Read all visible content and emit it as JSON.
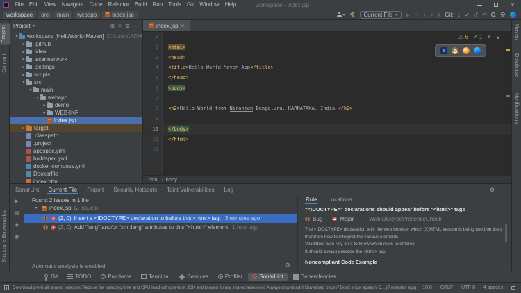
{
  "titlebar": {
    "menus": [
      "File",
      "Edit",
      "View",
      "Navigate",
      "Code",
      "Refactor",
      "Build",
      "Run",
      "Tools",
      "Git",
      "Window",
      "Help"
    ],
    "title": "workspace - index.jsp"
  },
  "toolbar": {
    "breadcrumbs": [
      "workspace",
      "src",
      "main",
      "webapp",
      "index.jsp"
    ],
    "run_config": "Current File",
    "git_label": "Git:"
  },
  "left_stripe": {
    "top": [
      "Project",
      "Commit"
    ],
    "bottom": [
      "Bookmarks",
      "Structure"
    ]
  },
  "right_stripe": [
    "Maven",
    "Database",
    "Notifications"
  ],
  "project": {
    "header": "Project",
    "tree": [
      {
        "label": "workspace [HelloWorld-Maven]",
        "suffix": "C:\\Users\\ADMIN\\jenkins",
        "indent": 0,
        "arrow": "down",
        "icon": "project"
      },
      {
        "label": ".github",
        "indent": 1,
        "arrow": "right",
        "icon": "folder"
      },
      {
        "label": ".idea",
        "indent": 1,
        "arrow": "right",
        "icon": "folder"
      },
      {
        "label": ".scannerwork",
        "indent": 1,
        "arrow": "right",
        "icon": "folder"
      },
      {
        "label": ".settings",
        "indent": 1,
        "arrow": "right",
        "icon": "folder"
      },
      {
        "label": "scripts",
        "indent": 1,
        "arrow": "right",
        "icon": "folder"
      },
      {
        "label": "src",
        "indent": 1,
        "arrow": "down",
        "icon": "folder"
      },
      {
        "label": "main",
        "indent": 2,
        "arrow": "down",
        "icon": "folder"
      },
      {
        "label": "webapp",
        "indent": 3,
        "arrow": "down",
        "icon": "folder"
      },
      {
        "label": "demo",
        "indent": 4,
        "arrow": "right",
        "icon": "folder"
      },
      {
        "label": "WEB-INF",
        "indent": 4,
        "arrow": "right",
        "icon": "folder"
      },
      {
        "label": "index.jsp",
        "indent": 4,
        "arrow": "none",
        "icon": "jsp",
        "selected": true
      },
      {
        "label": "target",
        "indent": 1,
        "arrow": "right",
        "icon": "folder-excluded",
        "excluded": true
      },
      {
        "label": ".classpath",
        "indent": 1,
        "arrow": "none",
        "icon": "config"
      },
      {
        "label": ".project",
        "indent": 1,
        "arrow": "none",
        "icon": "config"
      },
      {
        "label": "appspec.yml",
        "indent": 1,
        "arrow": "none",
        "icon": "yml"
      },
      {
        "label": "buildspec.yml",
        "indent": 1,
        "arrow": "none",
        "icon": "yml"
      },
      {
        "label": "docker-compose.yml",
        "indent": 1,
        "arrow": "none",
        "icon": "docker"
      },
      {
        "label": "Dockerfile",
        "indent": 1,
        "arrow": "none",
        "icon": "docker"
      },
      {
        "label": "index.html",
        "indent": 1,
        "arrow": "none",
        "icon": "html"
      }
    ]
  },
  "editor": {
    "tab": "index.jsp",
    "inspections": {
      "warnings": "6",
      "passed": "1"
    },
    "breadcrumb": [
      "html",
      "body"
    ],
    "browsers": [
      "ie",
      "chrome",
      "firefox",
      "edge"
    ],
    "lines": [
      {
        "n": "1",
        "segs": []
      },
      {
        "n": "2",
        "segs": [
          {
            "t": "<html>",
            "c": "tag hl-html"
          }
        ]
      },
      {
        "n": "3",
        "segs": [
          {
            "t": "<head>",
            "c": "tag"
          }
        ]
      },
      {
        "n": "4",
        "segs": [
          {
            "t": "<title>",
            "c": "tag"
          },
          {
            "t": "Hello World Maven App",
            "c": "txt"
          },
          {
            "t": "</title>",
            "c": "tag"
          }
        ]
      },
      {
        "n": "5",
        "segs": [
          {
            "t": "</head>",
            "c": "tag"
          }
        ]
      },
      {
        "n": "6",
        "segs": [
          {
            "t": "<body>",
            "c": "tag hl-body"
          }
        ]
      },
      {
        "n": "7",
        "segs": []
      },
      {
        "n": "8",
        "segs": [
          {
            "t": "<h2>",
            "c": "tag"
          },
          {
            "t": "Hello World from ",
            "c": "txt"
          },
          {
            "t": "Niranjan",
            "c": "txt typo"
          },
          {
            "t": " Bengaluru, KARNATAKA, India ",
            "c": "txt"
          },
          {
            "t": "</h2>",
            "c": "tag"
          }
        ]
      },
      {
        "n": "9",
        "segs": []
      },
      {
        "n": "10",
        "segs": [
          {
            "t": "</body>",
            "c": "tag hl-body"
          }
        ],
        "current": true
      },
      {
        "n": "11",
        "segs": [
          {
            "t": "</html>",
            "c": "tag"
          }
        ]
      },
      {
        "n": "12",
        "segs": []
      }
    ]
  },
  "sonarlint": {
    "label": "SonarLint:",
    "tabs": [
      {
        "label": "Current File",
        "selected": true
      },
      {
        "label": "Report"
      },
      {
        "label": "Security Hotspots"
      },
      {
        "label": "Taint Vulnerabilities"
      },
      {
        "label": "Log"
      }
    ],
    "summary": "Found 2 issues in 1 file",
    "file": {
      "name": "index.jsp",
      "count": "(2 issues)"
    },
    "issues": [
      {
        "pos": "(2, 0)",
        "text": "Insert a <!DOCTYPE> declaration to before this <html> tag.",
        "time": "3 minutes ago",
        "selected": true
      },
      {
        "pos": "(2, 0)",
        "text": "Add \"lang\" and/or \"xml:lang\" attributes to this \"<html>\" element",
        "time": "1 hour ago",
        "selected": false
      }
    ],
    "footer": "Automatic analysis is enabled",
    "rule": {
      "tabs": [
        {
          "label": "Rule",
          "selected": true
        },
        {
          "label": "Locations"
        }
      ],
      "title": "\"<!DOCTYPE>\" declarations should appear before \"<html>\" tags",
      "type": "Bug",
      "severity": "Major",
      "rule_key": "Web:DoctypePresenceCheck",
      "body": [
        "The <!DOCTYPE> declaration tells the web browser which (X)HTML version is being used on the page, and",
        "therefore how to interpret the various elements.",
        "Validators also rely on it to know which rules to enforce.",
        "It should always precede the <html> tag."
      ],
      "section_heading": "Noncompliant Code Example"
    }
  },
  "bottom_bar": {
    "items": [
      {
        "label": "Git",
        "icon": "git"
      },
      {
        "label": "TODO",
        "icon": "todo"
      },
      {
        "label": "Problems",
        "icon": "problems"
      },
      {
        "label": "Terminal",
        "icon": "terminal"
      },
      {
        "label": "Services",
        "icon": "services"
      },
      {
        "label": "Profiler",
        "icon": "profiler"
      },
      {
        "label": "SonarLint",
        "icon": "sonarlint",
        "selected": true
      },
      {
        "label": "Dependencies",
        "icon": "dependencies"
      }
    ]
  },
  "status_bar": {
    "message": "Download pre-built shared indexes: Reduce the indexing time and CPU load with pre-built JDK and Maven library shared indexes // Always download // Download once // Don't show again // C... (7 minutes ago)",
    "right": [
      "10:8",
      "CRLF",
      "UTF-8",
      "4 spaces"
    ]
  },
  "colors": {
    "panel": "#3c3f41",
    "editor_bg": "#2b2b2b",
    "selection_blue": "#4b6eaf",
    "issue_selection": "#3a6dbf",
    "tab_underline": "#4a88c7",
    "tag_yellow": "#e8bf6a",
    "warning_yellow": "#d9a343",
    "ok_green": "#5fad65",
    "error_red": "#c75450"
  }
}
